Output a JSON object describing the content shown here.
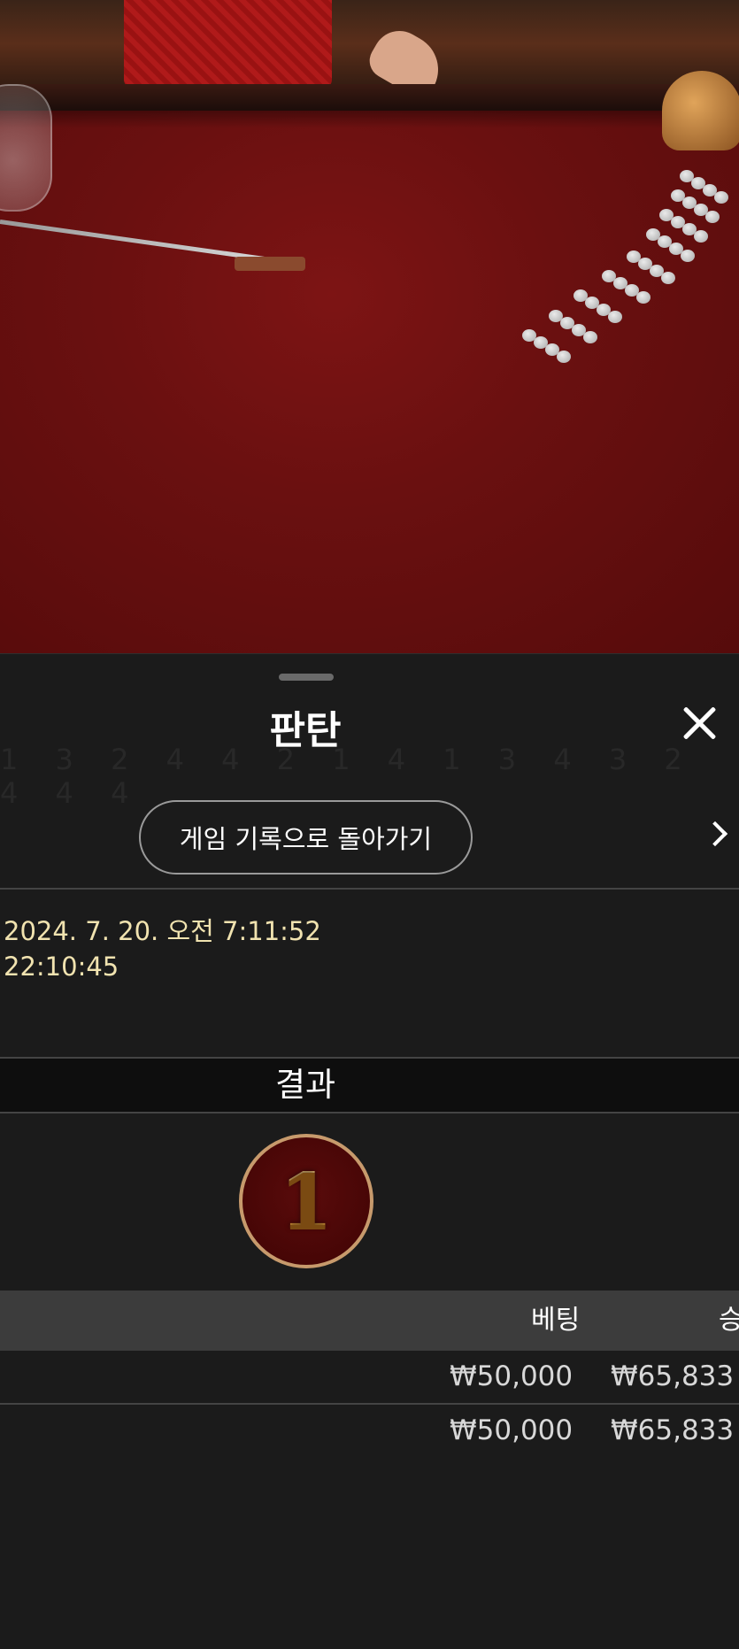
{
  "sheet": {
    "title": "판탄",
    "back_button": "게임 기록으로 돌아가기",
    "info": {
      "date": "2024. 7. 20. 오전 7:11:52",
      "round_id": "22:10:45"
    },
    "result_label": "결과",
    "result_value": "1",
    "table": {
      "headers": {
        "bet": "베팅",
        "win": "승"
      },
      "rows": [
        {
          "bet": "₩50,000",
          "win": "₩65,833"
        },
        {
          "bet": "₩50,000",
          "win": "₩65,833"
        }
      ]
    }
  },
  "ghost_digits": "1 3 2 4 4 2 1 4 1 3 4 3 2 4 4 4"
}
